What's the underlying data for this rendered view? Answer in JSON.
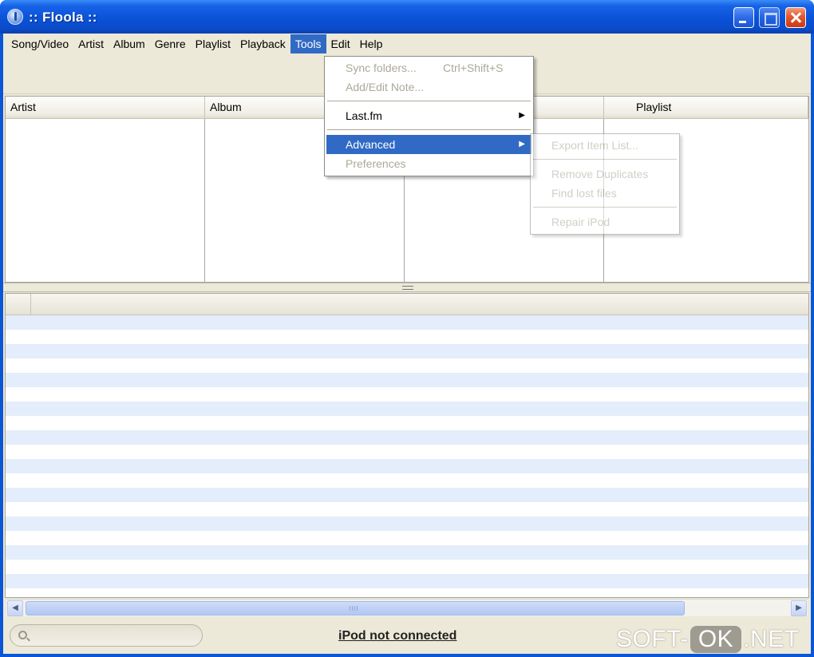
{
  "window": {
    "title": ":: Floola ::",
    "title_color": "#0a56d6",
    "icons": {
      "app": "floola-app-icon",
      "minimize": "minimize-icon",
      "maximize": "maximize-icon",
      "close": "close-icon"
    }
  },
  "menubar": {
    "items": [
      "Song/Video",
      "Artist",
      "Album",
      "Genre",
      "Playlist",
      "Playback",
      "Tools",
      "Edit",
      "Help"
    ],
    "active": "Tools",
    "highlight_color": "#316ac5"
  },
  "panes": {
    "headers": [
      "Artist",
      "Album",
      "",
      "Playlist"
    ]
  },
  "tools_menu": {
    "sync_folders": "Sync folders...",
    "sync_shortcut": "Ctrl+Shift+S",
    "add_edit_note": "Add/Edit Note...",
    "lastfm": "Last.fm",
    "advanced": "Advanced",
    "preferences": "Preferences"
  },
  "advanced_menu": {
    "export_item_list": "Export Item List...",
    "remove_duplicates": "Remove Duplicates",
    "find_lost_files": "Find lost files",
    "repair_ipod": "Repair iPod"
  },
  "statusbar": {
    "search_placeholder": "",
    "status": "iPod not connected"
  },
  "watermark": {
    "soft": "SOFT-",
    "ok": "OK",
    "net": ".NET"
  }
}
